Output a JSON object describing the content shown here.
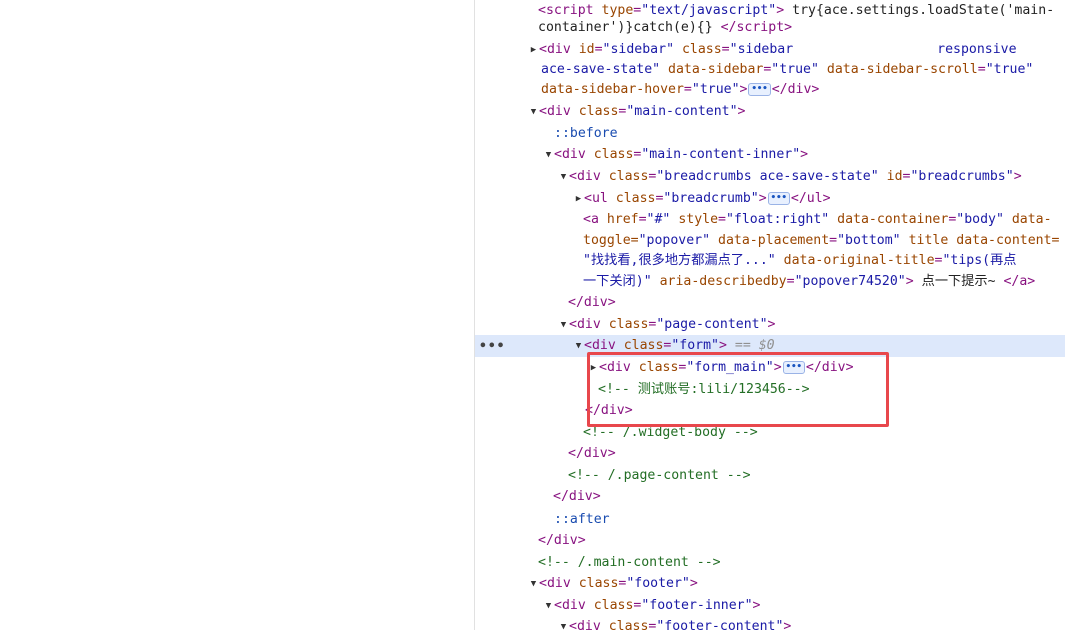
{
  "selected_marker": "== $0",
  "gutter_dots": "•••",
  "ellipsis": "•••",
  "lines": {
    "l1": {
      "text": "try{ace.settings.loadState('main-",
      "script_type": "\"text/javascript\""
    },
    "l2": {
      "text": "container')}catch(e){}"
    },
    "l3": {
      "id": "\"sidebar\"",
      "class": "\"sidebar",
      "class_tail": "responsive"
    },
    "l4": {
      "class_cont": "ace-save-state\"",
      "ds": "\"true\"",
      "dss": "\"true\""
    },
    "l5": {
      "dsh": "\"true\""
    },
    "l6": {
      "class": "\"main-content\""
    },
    "l7": {
      "pseudo": "::before"
    },
    "l8": {
      "class": "\"main-content-inner\""
    },
    "l9": {
      "class": "\"breadcrumbs ace-save-state\"",
      "id": "\"breadcrumbs\""
    },
    "l10": {
      "class": "\"breadcrumb\""
    },
    "l11": {
      "href": "\"#\"",
      "style": "\"float:right\"",
      "dc": "\"body\"",
      "dt_pre": "data-"
    },
    "l12": {
      "dt_post": "toggle=",
      "dt_val": "\"popover\"",
      "dp": "\"bottom\"",
      "title": "title",
      "dcon": "data-content="
    },
    "l13": {
      "dcon_val": "\"找找看,很多地方都漏点了...\"",
      "dot": "\"tips(再点"
    },
    "l14": {
      "dot_cont": "一下关闭)\"",
      "aria": "\"popover74520\"",
      "link_text": "点一下提示~"
    },
    "l16": {
      "class": "\"page-content\""
    },
    "l17": {
      "class": "\"form\""
    },
    "l18": {
      "class": "\"form_main\""
    },
    "l19": {
      "comment": "<!-- 测试账号:lili/123456-->"
    },
    "l21": {
      "comment": "<!-- /.widget-body -->"
    },
    "l23": {
      "comment": "<!-- /.page-content -->"
    },
    "l25": {
      "pseudo": "::after"
    },
    "l27": {
      "comment": "<!-- /.main-content -->"
    },
    "l28": {
      "class": "\"footer\""
    },
    "l29": {
      "class": "\"footer-inner\""
    },
    "l30": {
      "class": "\"footer-content\""
    }
  },
  "colors": {
    "tag": "#881280",
    "attr": "#994500",
    "value": "#1a1aa6",
    "comment": "#236e25",
    "selection": "#dde8fb",
    "highlight": "#e8474c"
  }
}
